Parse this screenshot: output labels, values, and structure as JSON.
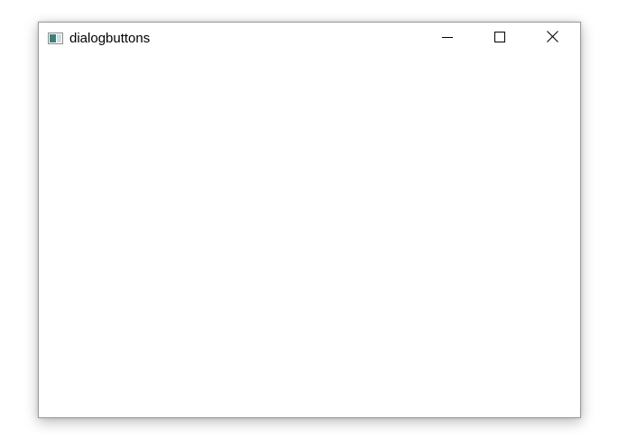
{
  "window": {
    "title": "dialogbuttons",
    "app_icon": "app-window-icon",
    "controls": {
      "minimize_icon": "minimize-icon",
      "maximize_icon": "maximize-icon",
      "close_icon": "close-icon"
    }
  }
}
